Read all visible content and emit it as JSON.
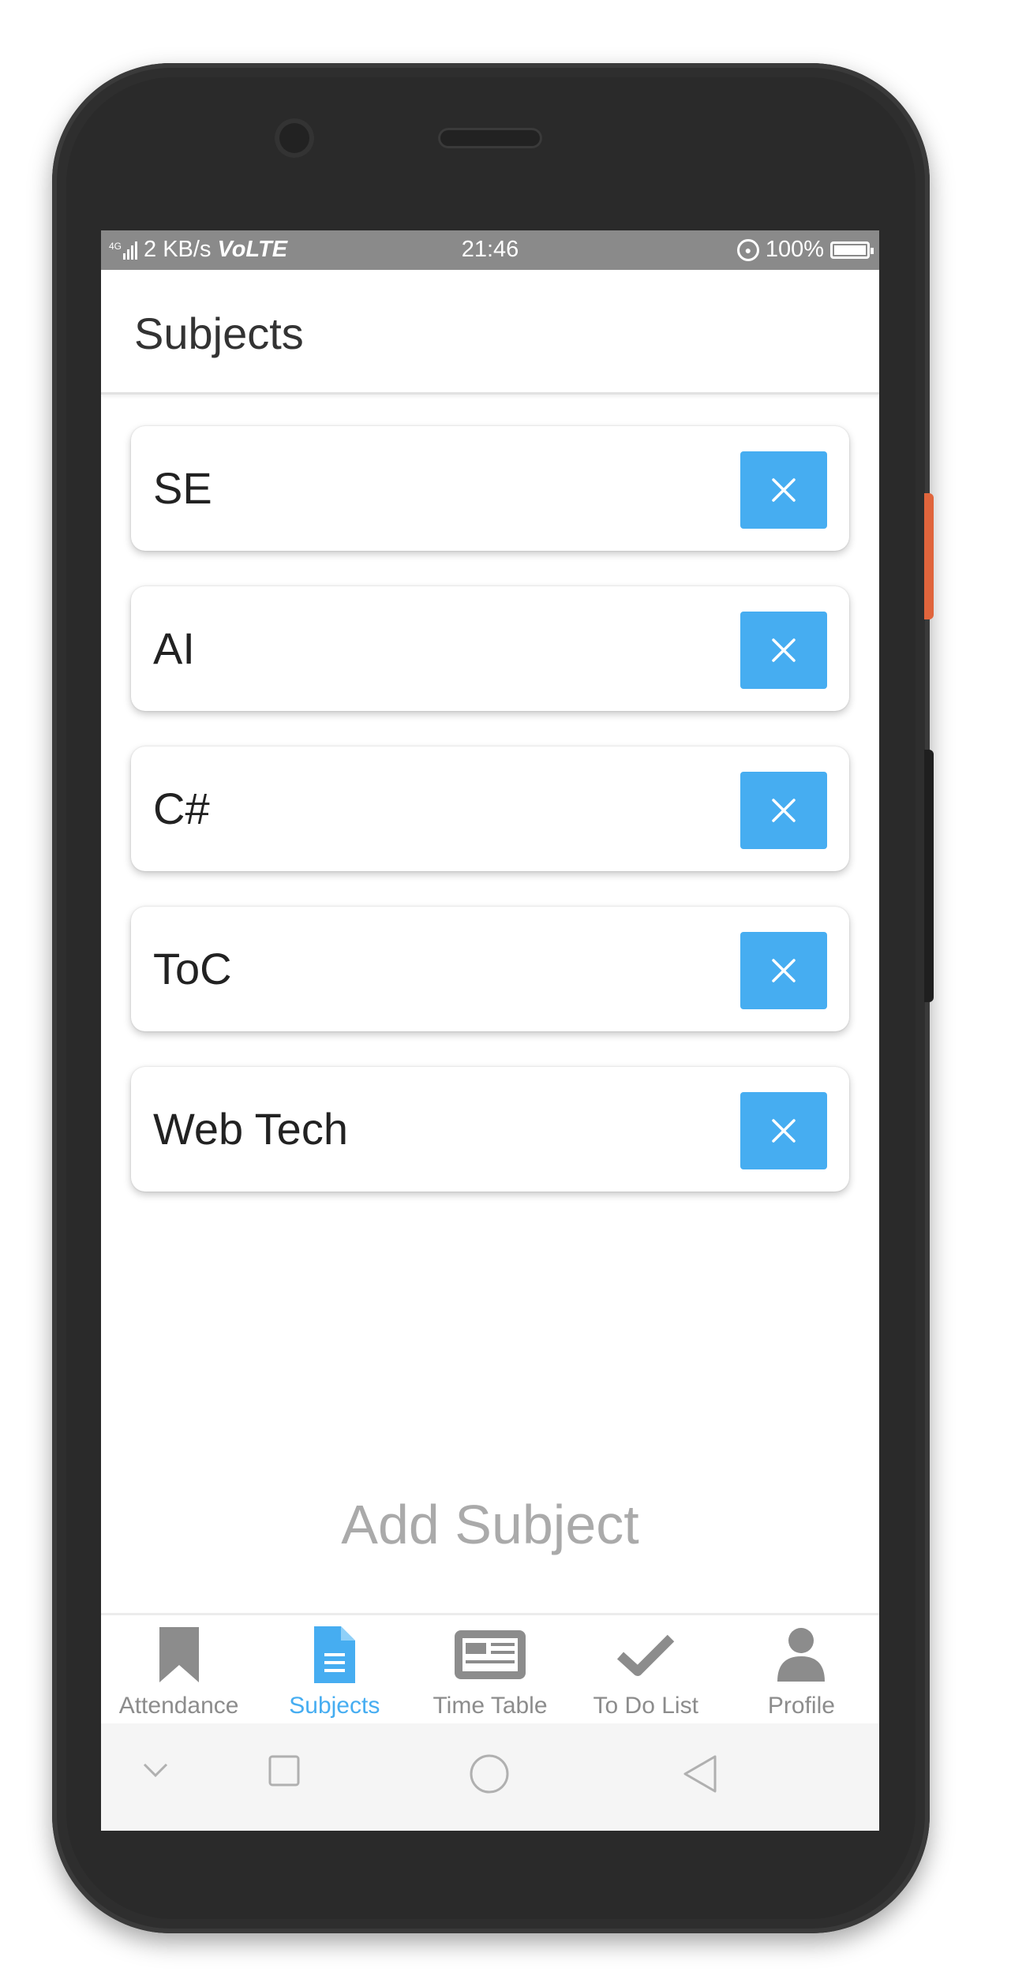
{
  "status_bar": {
    "network": "4G",
    "speed": "2 KB/s",
    "volte": "VoLTE",
    "time": "21:46",
    "battery": "100%"
  },
  "header": {
    "title": "Subjects"
  },
  "subjects": [
    {
      "name": "SE"
    },
    {
      "name": "AI"
    },
    {
      "name": "C#"
    },
    {
      "name": "ToC"
    },
    {
      "name": "Web Tech"
    }
  ],
  "add_subject_label": "Add Subject",
  "bottom_nav": {
    "items": [
      {
        "label": "Attendance",
        "icon": "bookmark-icon"
      },
      {
        "label": "Subjects",
        "icon": "document-icon",
        "active": true
      },
      {
        "label": "Time Table",
        "icon": "newspaper-icon"
      },
      {
        "label": "To Do List",
        "icon": "checkmark-icon"
      },
      {
        "label": "Profile",
        "icon": "user-icon"
      }
    ]
  },
  "colors": {
    "accent": "#46adf1",
    "inactive": "#8c8c8c",
    "status_bar": "#8a8a8a"
  }
}
